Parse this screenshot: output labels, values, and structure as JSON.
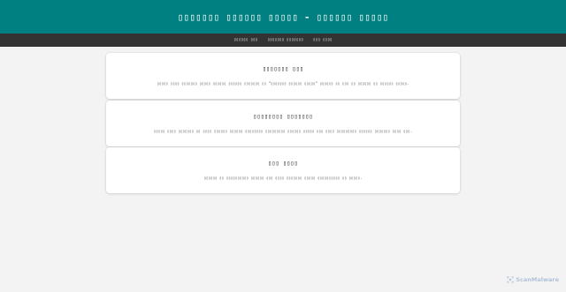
{
  "header": {
    "title": "▯▯▯▯▯▯▯ ▯▯▯▯▯▯ ▯▯▯▯▯ - ▯▯▯▯▯▯ ▯▯▯▯▯"
  },
  "nav": {
    "items": [
      {
        "label": "▯▯▯▯▯▯ ▯▯▯"
      },
      {
        "label": "▯▯▯▯▯▯▯ ▯▯▯▯▯▯▯"
      },
      {
        "label": "▯▯▯ ▯▯▯▯"
      }
    ]
  },
  "cards": [
    {
      "title": "▯▯▯▯▯▯▯ ▯▯▯",
      "text": "▯▯▯▯▯ ▯▯▯▯ ▯▯▯▯▯▯▯ ▯▯▯▯▯ ▯▯▯▯▯▯ ▯▯▯▯▯▯ ▯▯▯▯▯▯▯ ▯▯ \"▯▯▯▯▯▯▯ ▯▯▯▯▯▯ ▯▯▯▯▯\" ▯▯▯▯▯▯ ▯▯ ▯▯▯ ▯▯ ▯▯▯▯▯▯ ▯▯ ▯▯▯▯▯▯ ▯▯▯▯▯."
    },
    {
      "title": "▯▯▯▯▯▯▯▯ ▯▯▯▯▯▯▯",
      "text": "▯▯▯▯▯ ▯▯▯▯ ▯▯▯▯▯▯▯ ▯▯ ▯▯▯▯ ▯▯▯▯▯▯ ▯▯▯▯▯▯ ▯▯▯▯▯▯▯▯ ▯▯▯▯▯▯▯▯▯ ▯▯▯▯▯▯ ▯▯▯▯▯ ▯▯▯ ▯▯▯▯ ▯▯▯▯▯▯▯▯▯ ▯▯▯▯▯▯ ▯▯▯▯▯▯▯ ▯▯▯▯ ▯▯▯."
    },
    {
      "title": "▯▯▯ ▯▯▯▯",
      "text": "▯▯▯▯▯▯ ▯▯ ▯▯▯▯▯▯▯▯▯▯ ▯▯▯▯▯▯ ▯▯▯ ▯▯▯▯ ▯▯▯▯▯▯▯ ▯▯▯▯▯ ▯▯▯▯▯▯▯▯▯▯ ▯▯ ▯▯▯▯▯."
    }
  ],
  "watermark": {
    "text": "ScanMalware",
    "icon": "scanmalware-logo-icon",
    "color": "#7a9ac4"
  },
  "colors": {
    "header_bg": "#008080",
    "nav_bg": "#333333",
    "page_bg": "#f3f3f3",
    "card_bg": "#ffffff"
  }
}
